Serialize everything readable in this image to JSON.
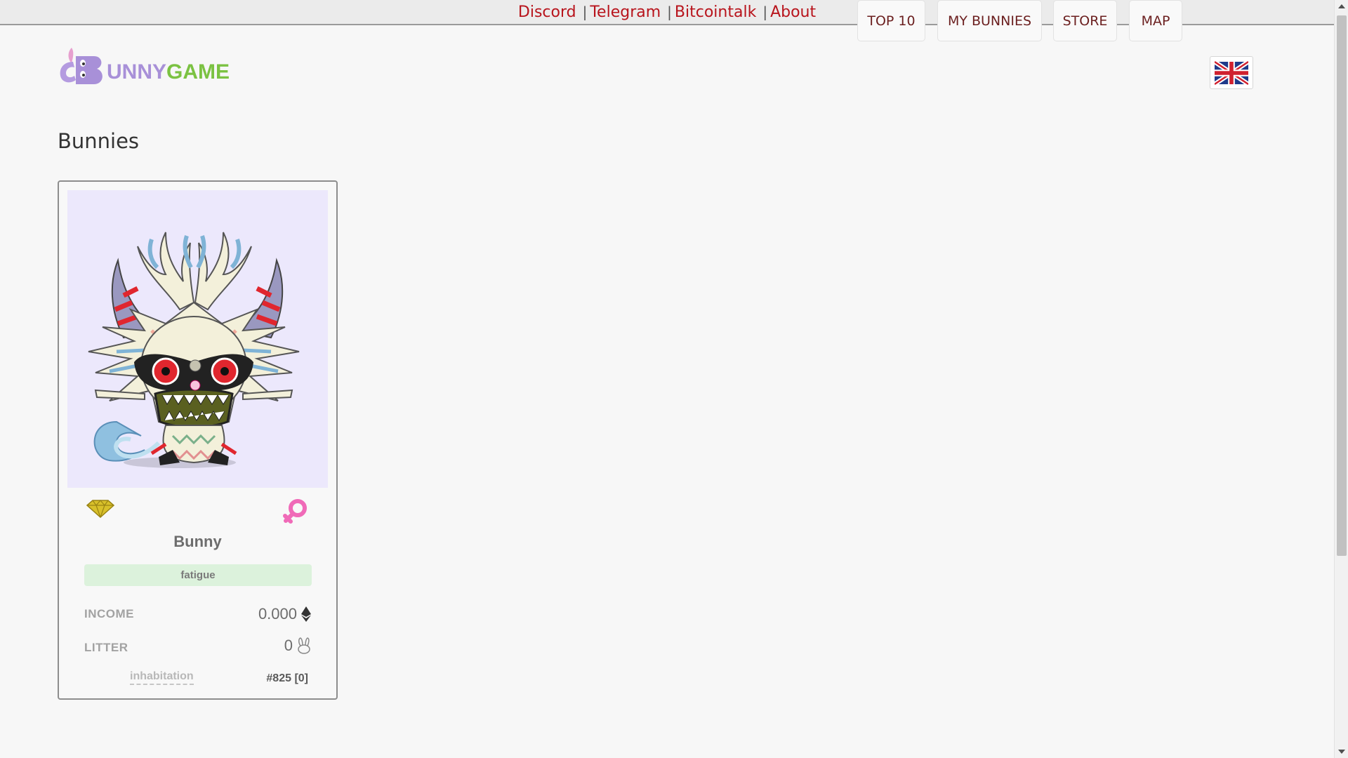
{
  "topbar": {
    "links": [
      {
        "label": "Discord"
      },
      {
        "label": "Telegram"
      },
      {
        "label": "Bitcointalk"
      },
      {
        "label": "About"
      }
    ],
    "separator": "|"
  },
  "header": {
    "logo": {
      "initial": "B",
      "part1": "UNNY",
      "part2": "GAME"
    },
    "nav": [
      {
        "label": "TOP 10"
      },
      {
        "label": "MY BUNNIES"
      },
      {
        "label": "STORE"
      },
      {
        "label": "MAP"
      }
    ],
    "language_flag": "uk-flag-icon"
  },
  "page": {
    "title": "Bunnies"
  },
  "card": {
    "name": "Bunny",
    "status": "fatigue",
    "income_label": "INCOME",
    "income_value": "0.000",
    "income_icon": "ethereum-icon",
    "litter_label": "LITTER",
    "litter_value": "0",
    "litter_icon": "bunny-outline-icon",
    "inhabitation_label": "inhabitation",
    "id_text": "#825 [0]",
    "gem_icon": "diamond-icon",
    "gender_icon": "female-icon",
    "colors": {
      "image_bg": "#ece8fc",
      "status_bg": "#dcf2dc",
      "gem": "#d8c02a",
      "gender": "#f06ab8"
    }
  },
  "colors": {
    "link": "#b8141c",
    "nav_text": "#6b1f1f",
    "logo_purple": "#a890d8",
    "logo_green": "#7bc242"
  }
}
